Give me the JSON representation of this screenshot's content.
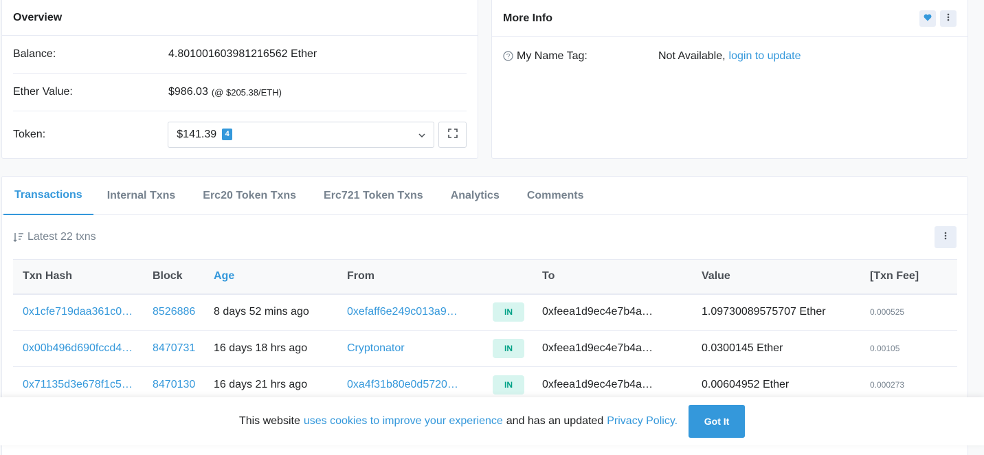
{
  "overview": {
    "title": "Overview",
    "balance_label": "Balance:",
    "balance_value": "4.801001603981216562 Ether",
    "ether_value_label": "Ether Value:",
    "ether_value": "$986.03",
    "ether_rate": "(@ $205.38/ETH)",
    "token_label": "Token:",
    "token_value": "$141.39",
    "token_count": "4"
  },
  "more_info": {
    "title": "More Info",
    "name_tag_label": "My Name Tag:",
    "name_tag_value": "Not Available,",
    "login_link": "login to update"
  },
  "tabs": [
    {
      "label": "Transactions"
    },
    {
      "label": "Internal Txns"
    },
    {
      "label": "Erc20 Token Txns"
    },
    {
      "label": "Erc721 Token Txns"
    },
    {
      "label": "Analytics"
    },
    {
      "label": "Comments"
    }
  ],
  "txn_summary": "Latest 22 txns",
  "table": {
    "headers": [
      "Txn Hash",
      "Block",
      "Age",
      "From",
      "",
      "To",
      "Value",
      "[Txn Fee]"
    ],
    "rows": [
      {
        "hash": "0x1cfe719daa361c0…",
        "block": "8526886",
        "age": "8 days 52 mins ago",
        "from": "0xefaff6e249c013a9…",
        "dir": "IN",
        "to": "0xfeea1d9ec4e7b4a…",
        "value": "1.09730089575707 Ether",
        "fee": "0.000525"
      },
      {
        "hash": "0x00b496d690fccd4…",
        "block": "8470731",
        "age": "16 days 18 hrs ago",
        "from": "Cryptonator",
        "dir": "IN",
        "to": "0xfeea1d9ec4e7b4a…",
        "value": "0.0300145 Ether",
        "fee": "0.00105"
      },
      {
        "hash": "0x71135d3e678f1c5…",
        "block": "8470130",
        "age": "16 days 21 hrs ago",
        "from": "0xa4f31b80e0d5720…",
        "dir": "IN",
        "to": "0xfeea1d9ec4e7b4a…",
        "value": "0.00604952 Ether",
        "fee": "0.000273"
      }
    ]
  },
  "cookie": {
    "text_before": "This website",
    "link1": "uses cookies to improve your experience",
    "text_middle": "and has an updated",
    "link2": "Privacy Policy.",
    "button": "Got It"
  }
}
